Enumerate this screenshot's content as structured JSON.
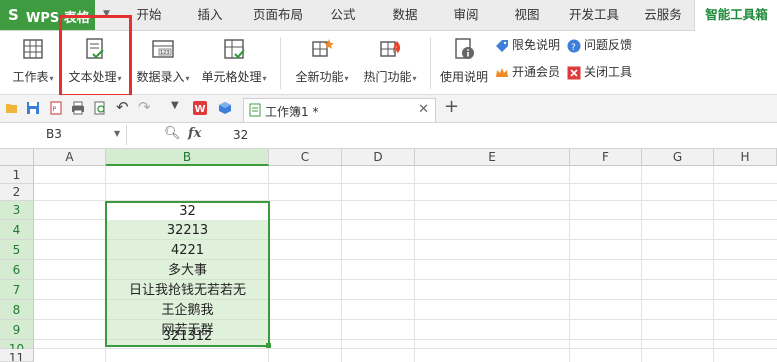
{
  "app": {
    "logo": "S",
    "title": "WPS 表格"
  },
  "menu_tabs": [
    "开始",
    "插入",
    "页面布局",
    "公式",
    "数据",
    "审阅",
    "视图",
    "开发工具",
    "云服务",
    "智能工具箱"
  ],
  "ribbon": {
    "worksheet": "工作表",
    "text_processing": "文本处理",
    "data_entry": "数据录入",
    "cell_processing": "单元格处理",
    "new_features": "全新功能",
    "hot_features": "热门功能",
    "usage_guide": "使用说明",
    "free_limit": "限免说明",
    "feedback": "问题反馈",
    "open_member": "开通会员",
    "close_tools": "关闭工具"
  },
  "doc_tab": {
    "label": "工作簿1 *"
  },
  "formula_bar": {
    "cell_ref": "B3",
    "fx": "fx",
    "value": "32"
  },
  "grid": {
    "columns": [
      "A",
      "B",
      "C",
      "D",
      "E",
      "F",
      "G",
      "H"
    ],
    "rows": [
      "1",
      "2",
      "3",
      "4",
      "5",
      "6",
      "7",
      "8",
      "9",
      "10",
      "11"
    ],
    "column_b_values": [
      "32",
      "32213",
      "4221",
      "多大事",
      "日让我抢钱无若若无",
      "王企鹅我",
      "网若无群",
      "321312"
    ]
  },
  "colors": {
    "accent": "#3f9b3f",
    "selection_border": "#3c9a3c",
    "highlight": "#e53030"
  }
}
